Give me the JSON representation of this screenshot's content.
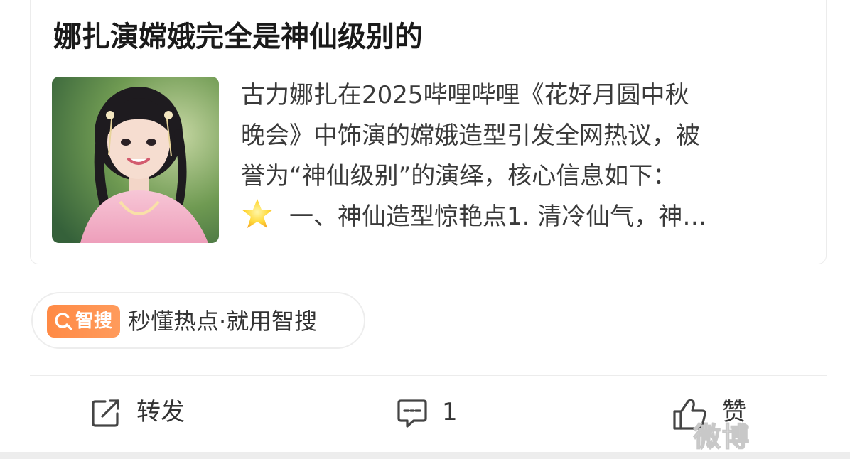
{
  "post": {
    "title": "娜扎演嫦娥完全是神仙级别的",
    "summary_lines": [
      "古力娜扎在2025哔哩哔哩《花好月圆中秋",
      "晚会》中饰演的嫦娥造型引发全网热议，被",
      "誉为“神仙级别”的演绎，核心信息如下：",
      "一、神仙造型惊艳点1. 清冷仙气，神…"
    ],
    "thumbnail_icon": "portrait-photo",
    "star_icon": "star-icon"
  },
  "search_pill": {
    "badge_label": "智搜",
    "text": "秒懂热点·就用智搜",
    "accent_color": "#ff8a45"
  },
  "actions": {
    "repost_label": "转发",
    "comment_count": "1",
    "like_label": "赞"
  },
  "watermark_text": "微博"
}
